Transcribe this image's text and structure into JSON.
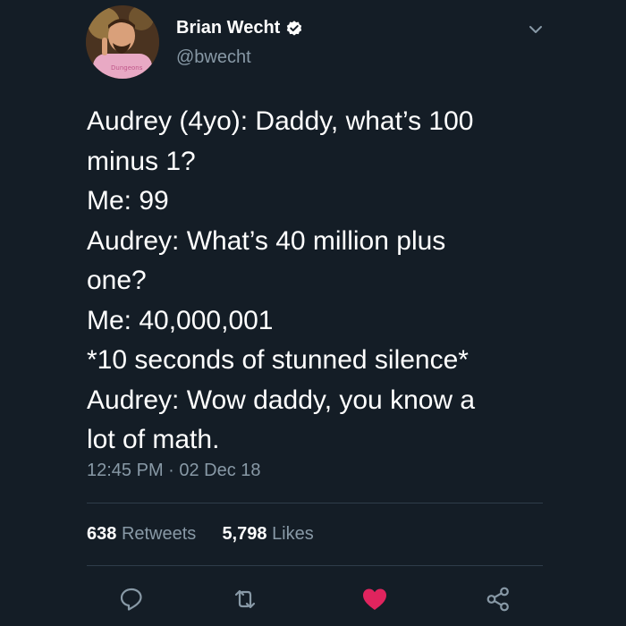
{
  "tweet": {
    "author": {
      "display_name": "Brian Wecht",
      "handle": "@bwecht",
      "verified": true,
      "avatar_shirt_text": "Dungeons"
    },
    "text_lines": [
      "Audrey (4yo): Daddy, what’s 100",
      "minus 1?",
      "Me: 99",
      "Audrey: What’s 40 million plus",
      "one?",
      "Me: 40,000,001",
      "*10 seconds of stunned silence*",
      "Audrey: Wow daddy, you know a",
      "lot of math."
    ],
    "timestamp": "12:45 PM · 02 Dec 18",
    "stats": {
      "retweets_count": "638",
      "retweets_label": "Retweets",
      "likes_count": "5,798",
      "likes_label": "Likes"
    },
    "actions": [
      "reply-icon",
      "retweet-icon",
      "like-icon",
      "share-icon"
    ],
    "colors": {
      "background": "#141d26",
      "text": "#ffffff",
      "secondary": "#8899a6",
      "like": "#e0245e",
      "verified": "#ffffff"
    }
  }
}
